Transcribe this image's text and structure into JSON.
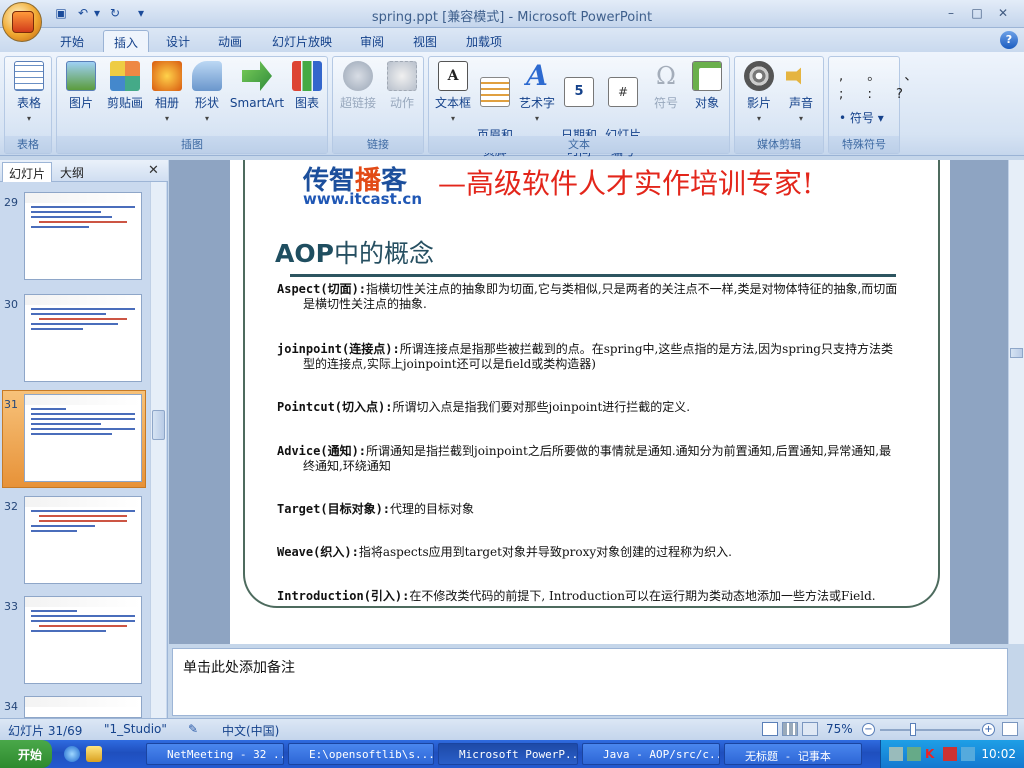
{
  "window": {
    "title": "spring.ppt [兼容模式] - Microsoft PowerPoint",
    "controls": [
      "–",
      "□",
      "✕"
    ]
  },
  "ribbon": {
    "tabs": [
      "开始",
      "插入",
      "设计",
      "动画",
      "幻灯片放映",
      "审阅",
      "视图",
      "加载项"
    ],
    "active_tab": "插入",
    "help": "?",
    "groups": {
      "tables": {
        "label": "表格",
        "buttons": [
          "表格"
        ]
      },
      "illustrations": {
        "label": "插图",
        "buttons": [
          "图片",
          "剪贴画",
          "相册",
          "形状",
          "SmartArt",
          "图表"
        ]
      },
      "links": {
        "label": "链接",
        "buttons": [
          "超链接",
          "动作"
        ]
      },
      "text": {
        "label": "文本",
        "buttons": [
          "文本框",
          "页眉和\n页脚",
          "艺术字",
          "日期和\n时间",
          "幻灯片\n编号",
          "符号",
          "对象"
        ]
      },
      "media": {
        "label": "媒体剪辑",
        "buttons": [
          "影片",
          "声音"
        ]
      },
      "special": {
        "label": "特殊符号",
        "buttons": [
          "符号"
        ],
        "glyphs": [
          ", 。 、",
          "; : ?"
        ]
      }
    }
  },
  "left_pane": {
    "tabs": [
      "幻灯片",
      "大纲"
    ],
    "active_tab": "幻灯片",
    "close": "✕",
    "slide_numbers": [
      "29",
      "30",
      "31",
      "32",
      "33",
      "34"
    ],
    "selected": "31"
  },
  "slide": {
    "brand_prefix": "传智",
    "brand_highlight": "播",
    "brand_suffix": "客",
    "brand_url": "www.itcast.cn",
    "slogan": "—高级软件人才实作培训专家!",
    "title_bold": "AOP",
    "title_rest": "中的概念",
    "items": [
      {
        "term": "Aspect(切面):",
        "desc": "指横切性关注点的抽象即为切面,它与类相似,只是两者的关注点不一样,类是对物体特征的抽象,而切面是横切性关注点的抽象."
      },
      {
        "term": "joinpoint(连接点):",
        "desc": "所谓连接点是指那些被拦截到的点。在spring中,这些点指的是方法,因为spring只支持方法类型的连接点,实际上joinpoint还可以是field或类构造器)"
      },
      {
        "term": "Pointcut(切入点):",
        "desc": "所谓切入点是指我们要对那些joinpoint进行拦截的定义."
      },
      {
        "term": "Advice(通知):",
        "desc": "所谓通知是指拦截到joinpoint之后所要做的事情就是通知.通知分为前置通知,后置通知,异常通知,最终通知,环绕通知"
      },
      {
        "term": "Target(目标对象):",
        "desc": "代理的目标对象"
      },
      {
        "term": "Weave(织入):",
        "desc": "指将aspects应用到target对象并导致proxy对象创建的过程称为织入."
      },
      {
        "term": "Introduction(引入):",
        "desc": "在不修改类代码的前提下, Introduction可以在运行期为类动态地添加一些方法或Field."
      }
    ]
  },
  "notes": {
    "placeholder": "单击此处添加备注"
  },
  "status": {
    "slide_counter": "幻灯片 31/69",
    "theme": "\"1_Studio\"",
    "language": "中文(中国)",
    "zoom": "75%"
  },
  "taskbar": {
    "start": "开始",
    "items": [
      "NetMeeting - 32 ...",
      "E:\\opensoftlib\\s...",
      "Microsoft PowerP...",
      "Java - AOP/src/c...",
      "无标题 - 记事本"
    ],
    "active_index": 2,
    "clock": "10:02"
  },
  "colors": {
    "accent": "#15428b",
    "slogan": "#e3261b",
    "title": "#264f61"
  }
}
